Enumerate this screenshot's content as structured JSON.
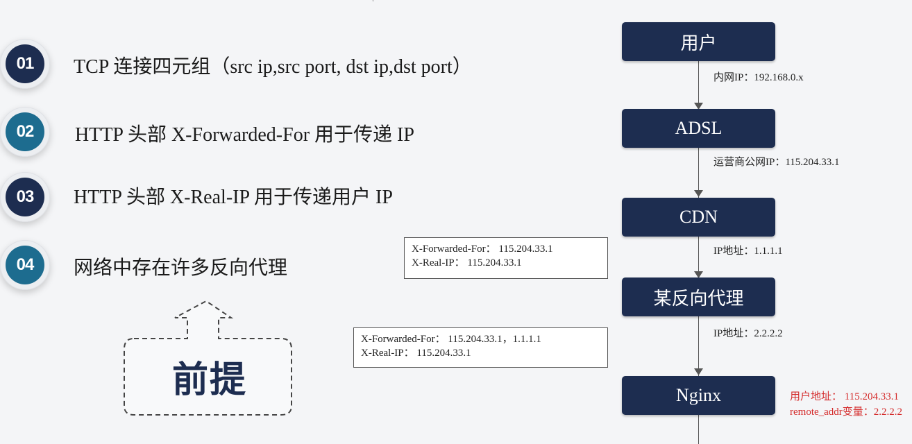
{
  "items": [
    {
      "number": "01",
      "text": "TCP 连接四元组（src ip,src port, dst ip,dst port）"
    },
    {
      "number": "02",
      "text": "HTTP 头部 X-Forwarded-For 用于传递 IP"
    },
    {
      "number": "03",
      "text": "HTTP 头部 X-Real-IP 用于传递用户 IP"
    },
    {
      "number": "04",
      "text": "网络中存在许多反向代理"
    }
  ],
  "premise": {
    "label": "前提"
  },
  "flow": {
    "nodes": [
      "用户",
      "ADSL",
      "CDN",
      "某反向代理",
      "Nginx"
    ],
    "edge_labels": [
      "内网IP：192.168.0.x",
      "运营商公网IP：115.204.33.1",
      "IP地址：1.1.1.1",
      "IP地址：2.2.2.2"
    ],
    "nginx_notes": [
      "用户地址：  115.204.33.1",
      "remote_addr变量：2.2.2.2"
    ]
  },
  "header_boxes": [
    {
      "line1": "X-Forwarded-For： 115.204.33.1",
      "line2": "X-Real-IP： 115.204.33.1"
    },
    {
      "line1": "X-Forwarded-For： 115.204.33.1，1.1.1.1",
      "line2": "X-Real-IP： 115.204.33.1"
    }
  ],
  "colors": {
    "navy": "#1d2d50",
    "teal": "#1d6c8f",
    "red": "#d42a2a"
  }
}
